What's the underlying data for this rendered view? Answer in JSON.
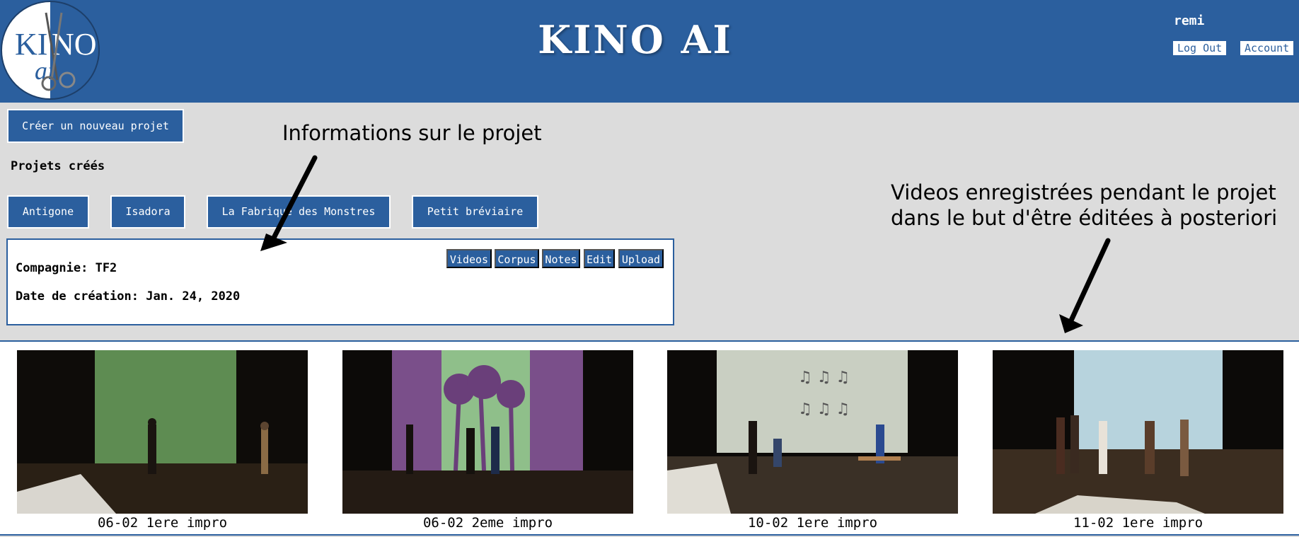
{
  "header": {
    "app_title": "KINO AI",
    "logo_text": {
      "left": "KI",
      "right": "NO",
      "sub": "ai"
    },
    "username": "remi",
    "logout_label": "Log Out",
    "account_label": "Account"
  },
  "actions": {
    "new_project_label": "Créer un nouveau projet"
  },
  "projects": {
    "section_title": "Projets créés",
    "items": [
      "Antigone",
      "Isadora",
      "La Fabrique des Monstres",
      "Petit bréviaire"
    ]
  },
  "project_info": {
    "company": "Compagnie: TF2",
    "creation_date": "Date de création: Jan. 24, 2020",
    "tabs": [
      "Videos",
      "Corpus",
      "Notes",
      "Edit",
      "Upload"
    ]
  },
  "annotations": {
    "info": "Informations sur le projet",
    "videos_line1": "Videos enregistrées pendant le projet",
    "videos_line2": "dans le but d'être éditées à posteriori"
  },
  "videos": [
    {
      "caption": "06-02 1ere impro",
      "screen_color": "#5e8c52"
    },
    {
      "caption": "06-02 2eme impro",
      "screen_color": "#7a4f8a"
    },
    {
      "caption": "10-02 1ere impro",
      "screen_color": "#c9cfc2"
    },
    {
      "caption": "11-02 1ere impro",
      "screen_color": "#b7d3dd"
    }
  ],
  "colors": {
    "brand_blue": "#2b5f9e",
    "page_bg": "#dcdcdc"
  }
}
